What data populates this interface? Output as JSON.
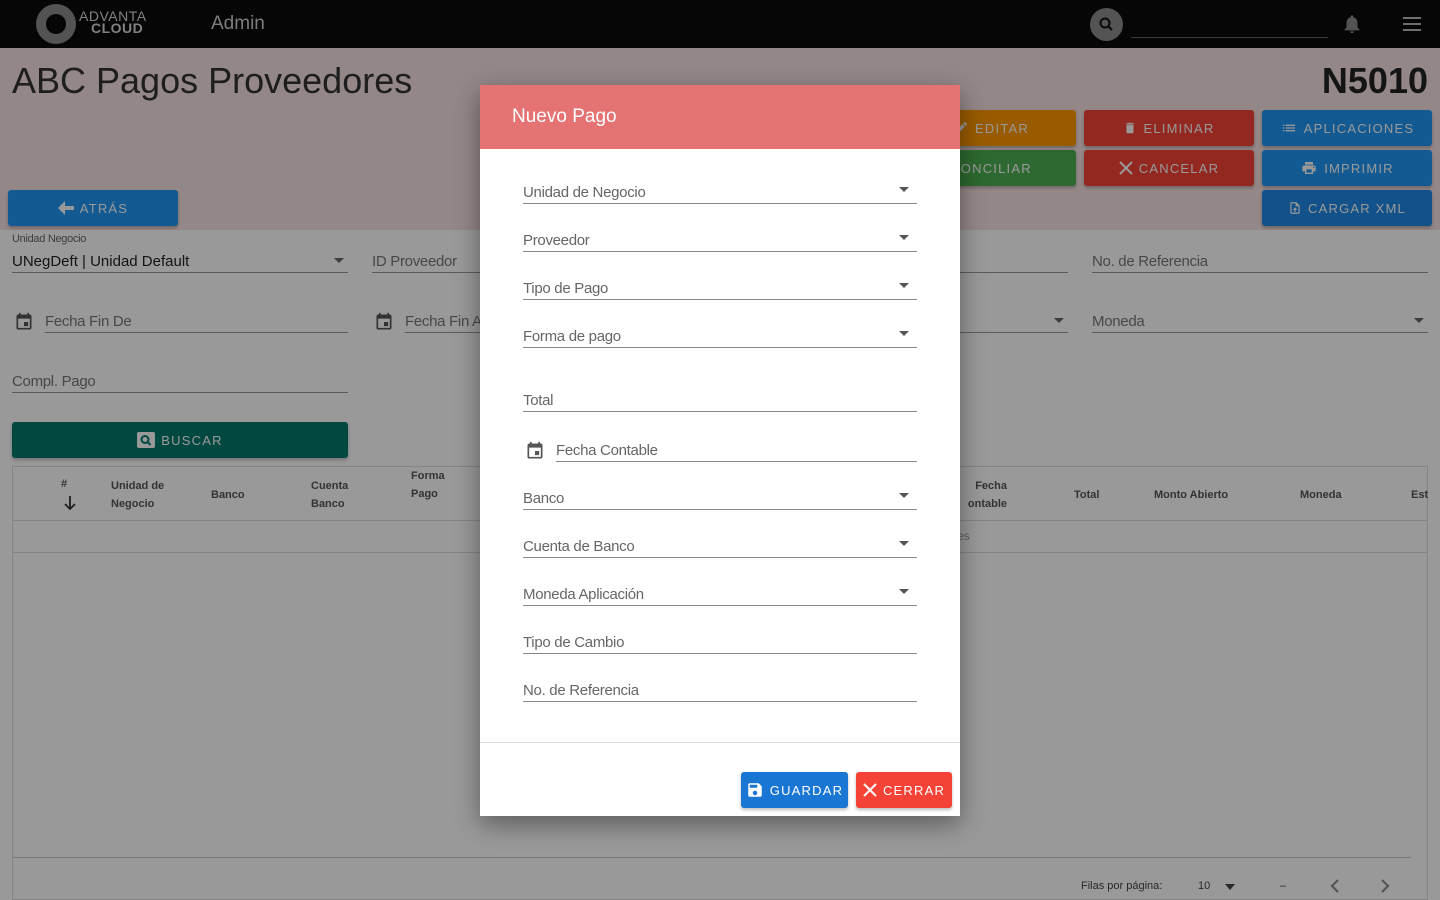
{
  "topbar": {
    "logo_line1": "ADVANTA",
    "logo_line2": "CLOUD",
    "app_label": "Admin",
    "search_value": ""
  },
  "header": {
    "title": "ABC Pagos Proveedores",
    "code": "N5010",
    "back_label": "ATRÁS",
    "buttons": {
      "editar": "EDITAR",
      "eliminar": "ELIMINAR",
      "aplicaciones": "APLICACIONES",
      "conciliar": "CONCILIAR",
      "cancelar": "CANCELAR",
      "imprimir": "IMPRIMIR",
      "cargar_xml": "CARGAR XML"
    }
  },
  "filters": {
    "unidad_negocio_label": "Unidad Negocio",
    "unidad_negocio_value": "UNegDeft | Unidad Default",
    "id_proveedor": "ID Proveedor",
    "no_referencia": "No. de Referencia",
    "fecha_fin_de": "Fecha Fin De",
    "fecha_fin_a": "Fecha Fin A",
    "moneda": "Moneda",
    "compl_pago": "Compl. Pago",
    "buscar_label": "BUSCAR"
  },
  "table": {
    "columns": {
      "num": "#",
      "unidad_negocio": "Unidad de Negocio",
      "banco": "Banco",
      "cuenta_banco": "Cuenta Banco",
      "forma_pago": "Forma Pago",
      "fecha_contable": "Fecha ontable",
      "total": "Total",
      "monto_abierto": "Monto Abierto",
      "moneda": "Moneda",
      "estado": "Est"
    },
    "no_data_fragment": "es",
    "rows_per_page_label": "Filas por página:",
    "rows_per_page_value": "10",
    "range": "–"
  },
  "modal": {
    "title": "Nuevo Pago",
    "fields": {
      "unidad_negocio": "Unidad de Negocio",
      "proveedor": "Proveedor",
      "tipo_pago": "Tipo de Pago",
      "forma_pago": "Forma de pago",
      "total": "Total",
      "fecha_contable": "Fecha Contable",
      "banco": "Banco",
      "cuenta_banco": "Cuenta de Banco",
      "moneda_aplicacion": "Moneda Aplicación",
      "tipo_cambio": "Tipo de Cambio",
      "no_referencia": "No. de Referencia"
    },
    "guardar_label": "GUARDAR",
    "cerrar_label": "CERRAR"
  },
  "colors": {
    "modal_header": "#e57373",
    "guardar": "#1976d2",
    "cerrar": "#f44336",
    "buscar": "#00796b",
    "header_band": "#f7e1e1"
  }
}
